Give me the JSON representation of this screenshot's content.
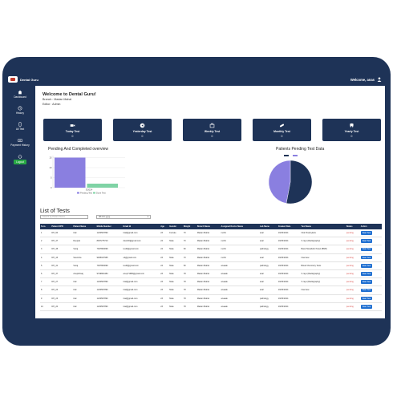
{
  "app": {
    "brand": "Dental Guru",
    "welcome_user": "Welcome, anas"
  },
  "sidebar": {
    "items": [
      {
        "label": "Dashboard",
        "icon": "home-icon"
      },
      {
        "label": "History",
        "icon": "history-icon"
      },
      {
        "label": "All Test",
        "icon": "mobile-icon"
      },
      {
        "label": "Payment History",
        "icon": "money-icon"
      }
    ],
    "logout": "Logout"
  },
  "header": {
    "title": "Welcome to Dental Guru!",
    "branch": "Branch : Madan Mahal",
    "role": "Editor : Admin"
  },
  "cards": [
    {
      "label": "Today Test",
      "value": "0",
      "icon": "video-icon"
    },
    {
      "label": "Yesterday Test",
      "value": "0",
      "icon": "rewind-icon"
    },
    {
      "label": "Weekly Test",
      "value": "0",
      "icon": "briefcase-icon"
    },
    {
      "label": "Monthly Test",
      "value": "0",
      "icon": "pills-icon"
    },
    {
      "label": "Yearly Test",
      "value": "0",
      "icon": "tooth-icon"
    }
  ],
  "charts": {
    "left_title": "Pending And Completed overview",
    "right_title": "Patients Pending Test Data"
  },
  "chart_data": [
    {
      "type": "bar",
      "title": "Pending And Completed overview",
      "categories": [
        "3/2024"
      ],
      "series": [
        {
          "name": "Pending Test",
          "values": [
            15
          ],
          "color": "#8a7fe0"
        },
        {
          "name": "Done Test",
          "values": [
            2
          ],
          "color": "#7fd3a5"
        }
      ],
      "ylim": [
        0,
        16
      ],
      "yticks": [
        "15",
        "10",
        "5",
        "0"
      ],
      "grid": true,
      "legend": "bottom"
    },
    {
      "type": "pie",
      "title": "Patients Pending Test Data",
      "slices": [
        {
          "name": "",
          "value": 53,
          "color": "#1e3357"
        },
        {
          "name": "",
          "value": 47,
          "color": "#8a7fe0"
        }
      ],
      "legend": "top"
    }
  ],
  "table": {
    "title": "List of Tests",
    "search_placeholder": "Search by Patient Name",
    "filter_value": "dd-mm-yyyy",
    "columns": [
      "S.no.",
      "Patient OPD",
      "Patient Name",
      "Mobile Number",
      "Email Id",
      "Age",
      "Gender",
      "Weight",
      "Branch Name",
      "Assigned Doctor Name",
      "Lab Name",
      "Created Date",
      "Test Name",
      "Status",
      "Action"
    ],
    "rows": [
      [
        "1",
        "DH_50",
        "trial",
        "1234567890",
        "trial@gmail.com",
        "23",
        "Female",
        "70",
        "Madan Mahal",
        "mohit",
        "anal",
        "19/03/2024",
        "Oral Prophylaxis",
        "pending",
        "Start Test"
      ],
      [
        "2",
        "DH_47",
        "Deepak",
        "8457275710",
        "dtest46@gmail.com",
        "24",
        "Male",
        "70",
        "Madan Mahal",
        "mohit",
        "anal",
        "19/03/2024",
        "X-rays (Radiography)",
        "pending",
        "Start Test"
      ],
      [
        "3",
        "DH_45",
        "Suraj",
        "7947860099",
        "test6@gmail.com",
        "24",
        "Male",
        "60",
        "Madan Mahal",
        "mohit",
        "pathology",
        "19/03/2024",
        "Basic Metabolic Panel (BMP)",
        "pending",
        "Start Test"
      ],
      [
        "4",
        "DH_43",
        "Soumitra",
        "9465047965",
        "s4@gmail.com",
        "23",
        "Male",
        "70",
        "Madan Mahal",
        "mohit",
        "anal",
        "19/03/2024",
        "Interview",
        "pending",
        "Start Test"
      ],
      [
        "5",
        "DH_41",
        "Suraj",
        "7947860099",
        "test6@gmail.com",
        "24",
        "Male",
        "60",
        "Madan Mahal",
        "anaaak",
        "pathology",
        "19/03/2024",
        "Blood Chemistry Tests",
        "pending",
        "Start Test"
      ],
      [
        "6",
        "DH_37",
        "Anupdhwaj",
        "9749804484",
        "anup71980@gmail.com",
        "23",
        "Male",
        "78",
        "Madan Mahal",
        "anaaak",
        "anal",
        "19/03/2024",
        "X-rays (Radiography)",
        "pending",
        "Start Test"
      ],
      [
        "7",
        "DH_27",
        "trial",
        "1234567890",
        "trial@gmail.com",
        "23",
        "Male",
        "78",
        "Madan Mahal",
        "anaaak",
        "anal",
        "19/03/2024",
        "X-rays (Radiography)",
        "pending",
        "Start Test"
      ],
      [
        "8",
        "DH_24",
        "trial",
        "1234567890",
        "trial@gmail.com",
        "23",
        "Male",
        "78",
        "Madan Mahal",
        "anaaak",
        "anal",
        "19/03/2024",
        "Interview",
        "pending",
        "Start Test"
      ],
      [
        "9",
        "DH_23",
        "trial",
        "1234567890",
        "trial@gmail.com",
        "23",
        "Male",
        "78",
        "Madan Mahal",
        "anaaak",
        "pathology",
        "19/03/2024",
        "",
        "pending",
        "Start Test"
      ],
      [
        "10",
        "DH_20",
        "trial",
        "1234567890",
        "trial@gmail.com",
        "23",
        "Male",
        "78",
        "Madan Mahal",
        "anaaak",
        "pathology",
        "19/03/2024",
        "",
        "pending",
        "Start Test"
      ]
    ]
  }
}
